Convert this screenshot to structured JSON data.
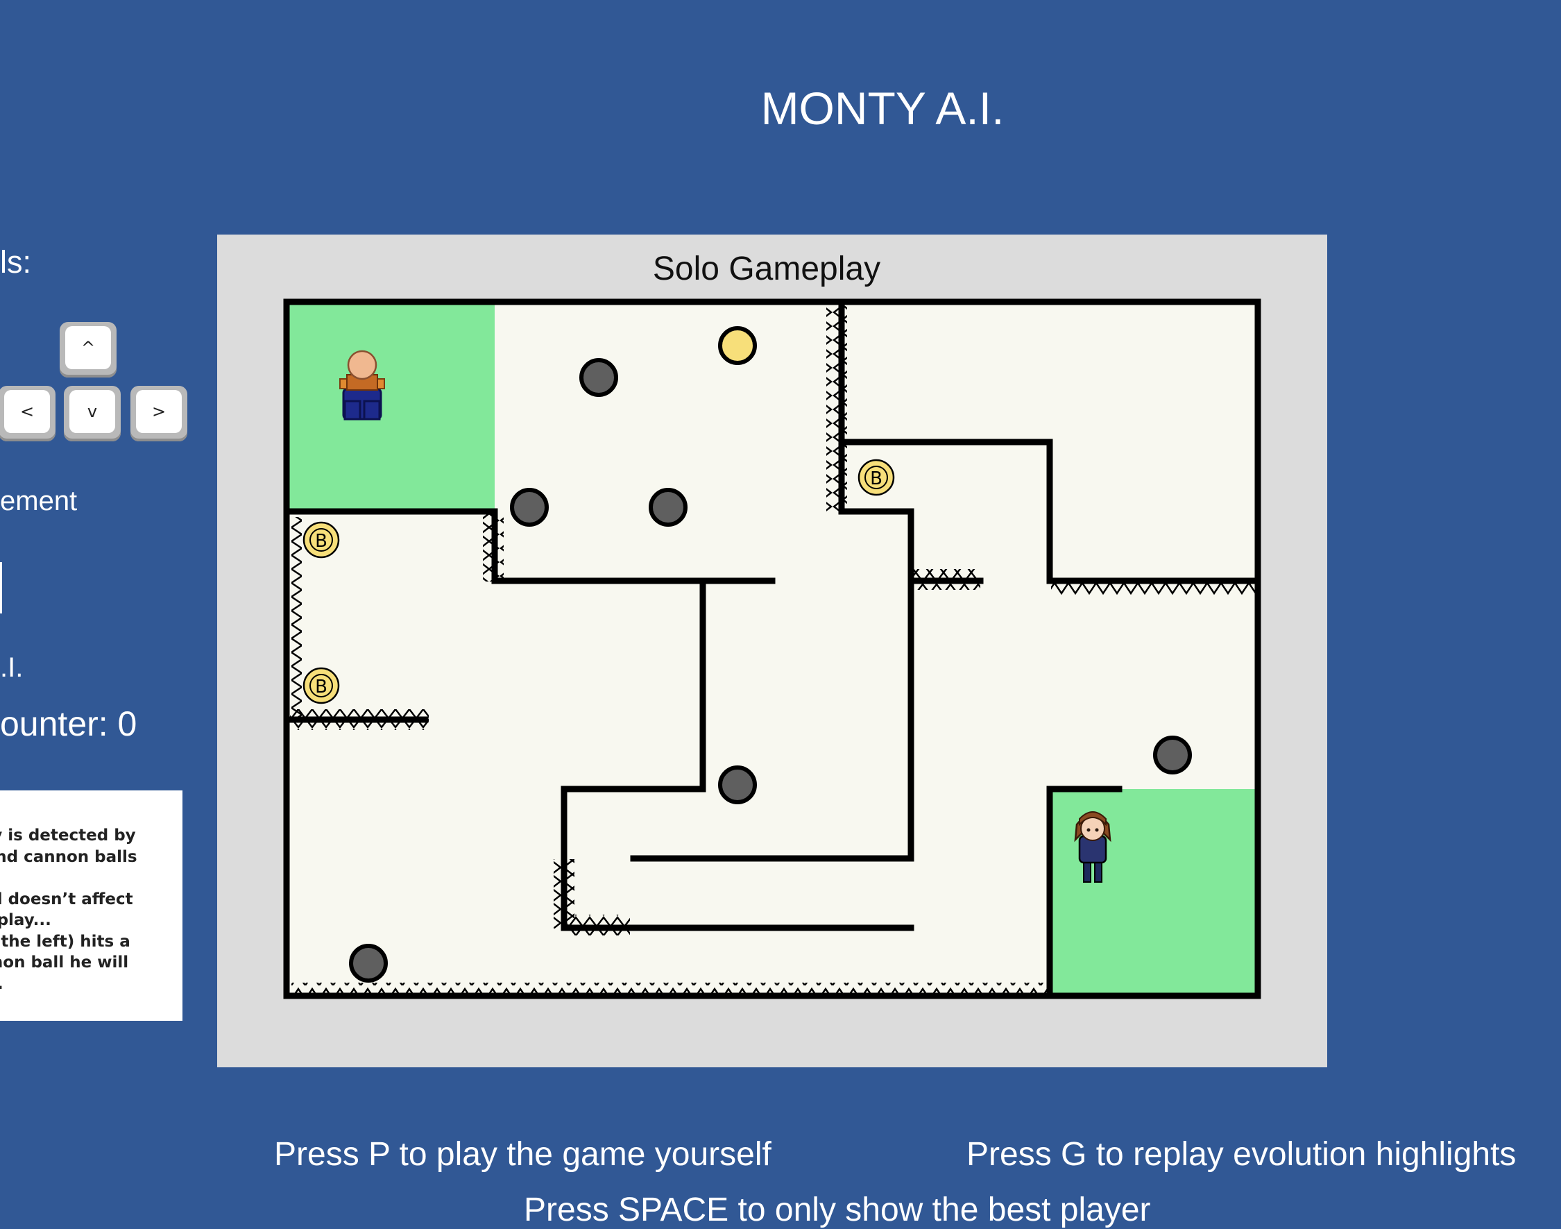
{
  "app": {
    "title": "MONTY A.I."
  },
  "sidebar": {
    "controls_label": "ls:",
    "keys": {
      "up": "^",
      "left": "<",
      "down": "v",
      "right": ">"
    },
    "movement_label": "ement",
    "ai_label": ".I.",
    "counter_label": "ounter: 0",
    "info_lines": [
      "ody is detected by",
      "s and cannon balls",
      "",
      "ead doesn’t affect",
      "meplay...",
      "(to the left) hits a",
      "annon ball he will",
      "die."
    ]
  },
  "game": {
    "panel_title": "Solo Gameplay",
    "coin_label": "B",
    "colors": {
      "panel": "#dcdcdc",
      "floor": "#f8f8f0",
      "safe_zone": "#82e89a",
      "wall": "#000000",
      "cannon_ball": "#5f5f5f",
      "coin": "#f7df7a",
      "background": "#315895"
    }
  },
  "footer": {
    "play_hint": "Press P to play the game yourself",
    "replay_hint": "Press G to replay evolution highlights",
    "space_hint": "Press SPACE to only show the best player"
  }
}
